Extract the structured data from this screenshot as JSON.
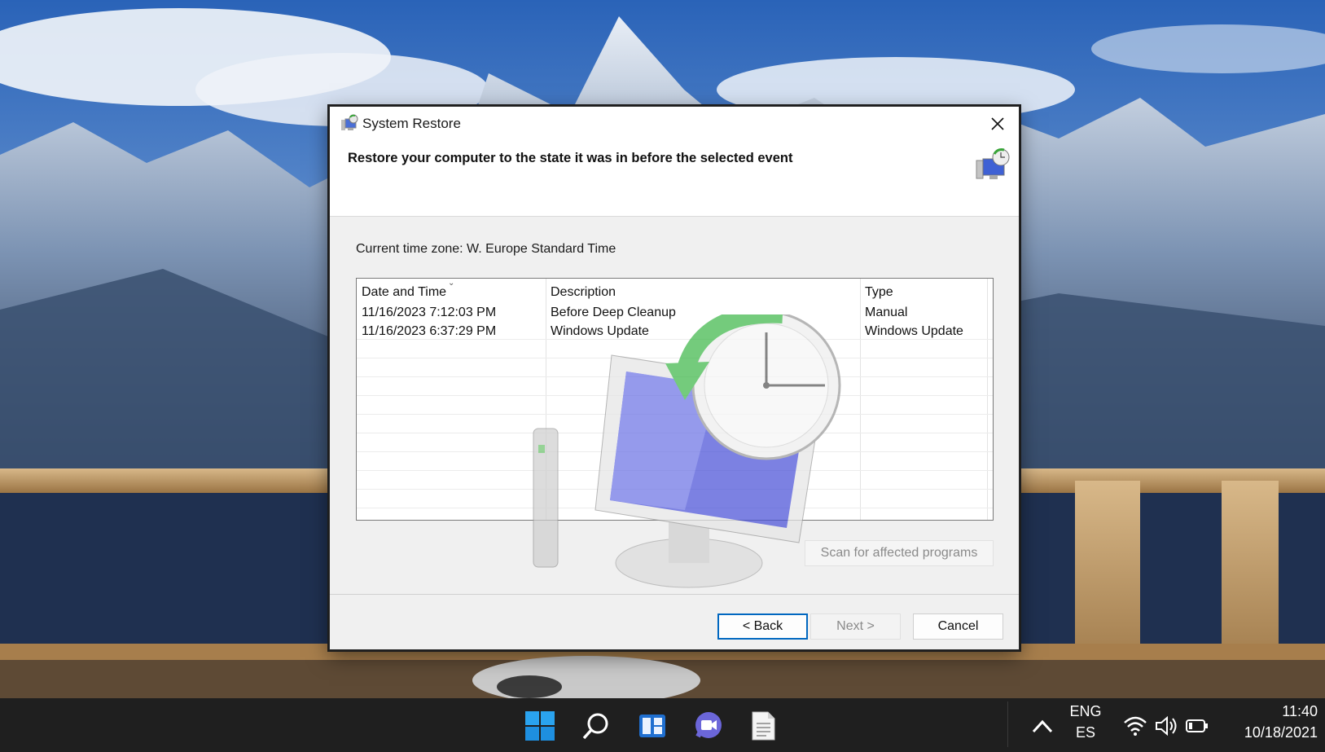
{
  "dialog": {
    "title": "System Restore",
    "heading": "Restore your computer to the state it was in before the selected event",
    "timezone": "Current time zone: W. Europe Standard Time",
    "columns": {
      "date": "Date and Time",
      "description": "Description",
      "type": "Type"
    },
    "rows": [
      {
        "date": "11/16/2023 7:12:03 PM",
        "description": "Before Deep Cleanup",
        "type": "Manual"
      },
      {
        "date": "11/16/2023 6:37:29 PM",
        "description": "Windows Update",
        "type": "Windows Update"
      }
    ],
    "scan_label": "Scan for affected programs",
    "back_label": "< Back",
    "next_label": "Next >",
    "cancel_label": "Cancel"
  },
  "taskbar": {
    "icons": [
      "windows-start-icon",
      "search-icon",
      "widgets-icon",
      "teams-chat-icon",
      "notepad-icon"
    ],
    "lang_top": "ENG",
    "lang_bottom": "ES",
    "time": "11:40",
    "date": "10/18/2021"
  },
  "colors": {
    "accent": "#0067c0",
    "taskbar": "#1f1f1f",
    "dialog_bg": "#f0f0f0"
  }
}
